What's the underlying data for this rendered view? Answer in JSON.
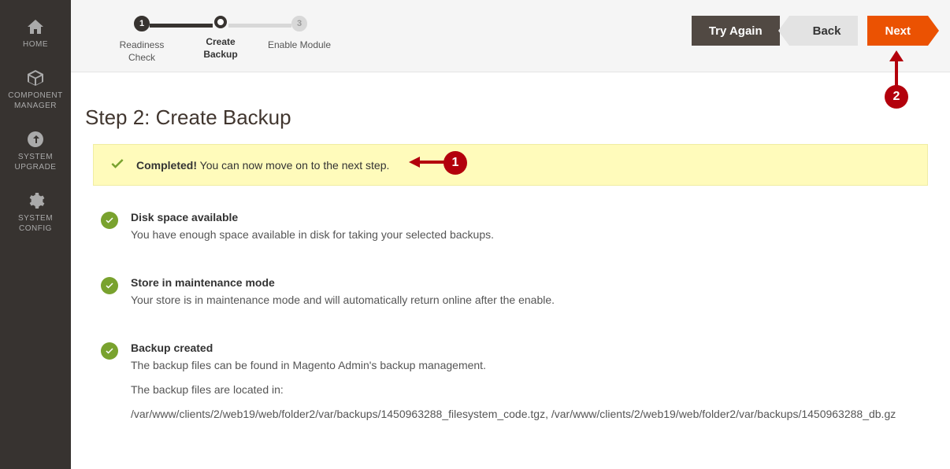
{
  "sidebar": {
    "items": [
      {
        "label": "HOME"
      },
      {
        "label": "COMPONENT\nMANAGER"
      },
      {
        "label": "SYSTEM\nUPGRADE"
      },
      {
        "label": "SYSTEM\nCONFIG"
      }
    ]
  },
  "stepper": {
    "steps": [
      {
        "num": "1",
        "label": "Readiness\nCheck"
      },
      {
        "num": "",
        "label": "Create\nBackup"
      },
      {
        "num": "3",
        "label": "Enable Module"
      }
    ]
  },
  "actions": {
    "try_again": "Try Again",
    "back": "Back",
    "next": "Next"
  },
  "page": {
    "title": "Step 2: Create Backup"
  },
  "alert": {
    "strong": "Completed!",
    "text": " You can now move on to the next step."
  },
  "sections": [
    {
      "title": "Disk space available",
      "lines": [
        "You have enough space available in disk for taking your selected backups."
      ]
    },
    {
      "title": "Store in maintenance mode",
      "lines": [
        "Your store is in maintenance mode and will automatically return online after the enable."
      ]
    },
    {
      "title": "Backup created",
      "lines": [
        "The backup files can be found in Magento Admin's backup management.",
        "The backup files are located in:",
        "/var/www/clients/2/web19/web/folder2/var/backups/1450963288_filesystem_code.tgz, /var/www/clients/2/web19/web/folder2/var/backups/1450963288_db.gz"
      ]
    }
  ],
  "annotations": {
    "a1": "1",
    "a2": "2"
  }
}
